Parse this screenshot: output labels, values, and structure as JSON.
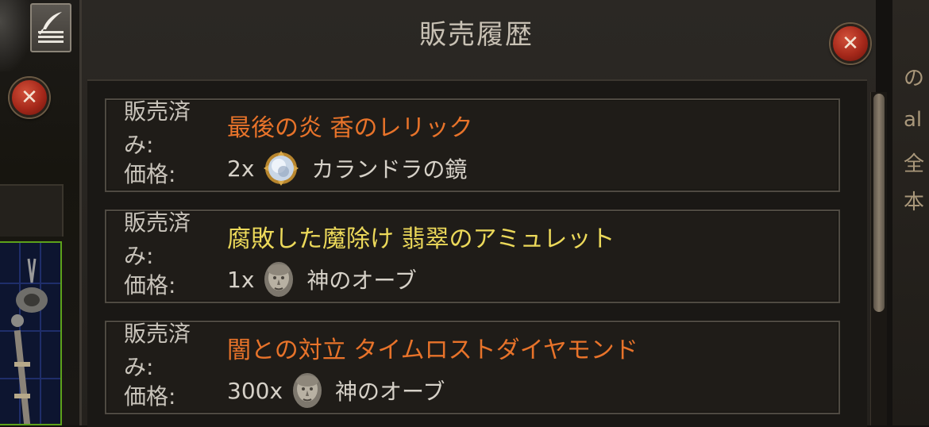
{
  "window": {
    "title": "販売履歴",
    "close_symbol": "✕"
  },
  "left": {
    "close_symbol": "✕",
    "feather_icon": "quill-icon"
  },
  "right_clip": [
    "の",
    "al",
    "全",
    "本"
  ],
  "labels": {
    "sold": "販売済み:",
    "price": "価格:"
  },
  "entries": [
    {
      "item_name": "最後の炎 香のレリック",
      "name_color": "#e8732a",
      "quantity": "2x",
      "currency_icon": "mirror-of-kalandra-icon",
      "currency": "カランドラの鏡"
    },
    {
      "item_name": "腐敗した魔除け 翡翠のアミュレット",
      "name_color": "#ecd95a",
      "quantity": "1x",
      "currency_icon": "divine-orb-icon",
      "currency": "神のオーブ"
    },
    {
      "item_name": "闇との対立 タイムロストダイヤモンド",
      "name_color": "#e8732a",
      "quantity": "300x",
      "currency_icon": "divine-orb-icon",
      "currency": "神のオーブ"
    }
  ]
}
